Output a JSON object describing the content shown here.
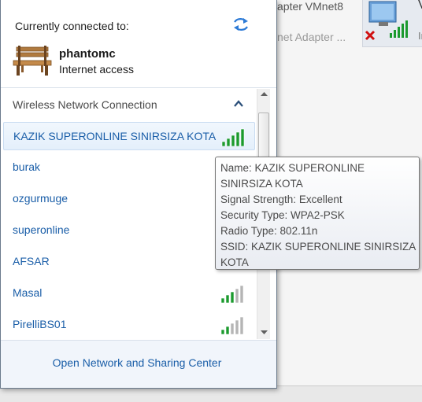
{
  "background": {
    "adapter_name_1": "apter VMnet8",
    "adapter_type_1": "net Adapter ...",
    "right_letter_top": "V",
    "right_letter_bottom": "Ir"
  },
  "header": {
    "connected_label": "Currently connected to:",
    "network_name": "phantomc",
    "network_status": "Internet access",
    "refresh_icon": "refresh-arrows-icon",
    "network_icon": "bench-icon"
  },
  "section": {
    "label": "Wireless Network Connection",
    "collapse_icon": "chevron-up-icon"
  },
  "networks": [
    {
      "label": "KAZIK SUPERONLINE SINIRSIZA KOTA",
      "signal_bars": 5,
      "selected": true,
      "signal_color": "#1b9a2e"
    },
    {
      "label": "burak"
    },
    {
      "label": "ozgurmuge"
    },
    {
      "label": "superonline"
    },
    {
      "label": "AFSAR"
    },
    {
      "label": "Masal",
      "signal_bars": 3,
      "signal_color": "#1b9a2e"
    },
    {
      "label": "PirelliBS01",
      "signal_bars": 2,
      "signal_color": "#1b9a2e"
    }
  ],
  "footer": {
    "link_label": "Open Network and Sharing Center"
  },
  "tooltip": {
    "lines": [
      "Name: KAZIK SUPERONLINE",
      "SINIRSIZA KOTA",
      "Signal Strength: Excellent",
      "Security Type: WPA2-PSK",
      "Radio Type: 802.11n",
      "SSID: KAZIK SUPERONLINE SINIRSIZA",
      "KOTA"
    ]
  },
  "colors": {
    "link": "#1a5ea8",
    "signal_active": "#1b9a2e",
    "signal_inactive": "#b5b5b5"
  }
}
